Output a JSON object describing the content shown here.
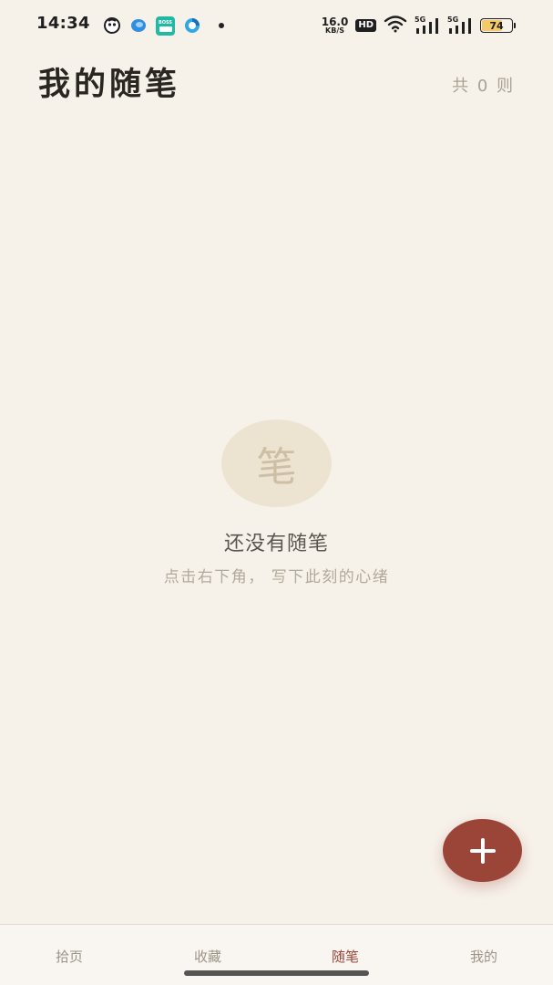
{
  "status_bar": {
    "time": "14:34",
    "net_speed_value": "16.0",
    "net_speed_unit": "KB/S",
    "hd_badge": "HD",
    "sim1_tag": "5G",
    "sim2_tag": "5G",
    "battery_level": "74",
    "battery_fraction": 0.74,
    "app_icons": [
      "app-icon",
      "messenger-icon",
      "boss-app-icon",
      "browser-icon"
    ],
    "boss_icon_text": "BOSS",
    "colors": {
      "battery_fill": "#f3c96a"
    }
  },
  "header": {
    "title": "我的随笔",
    "count_label": "共 0 则"
  },
  "empty_state": {
    "badge_char": "笔",
    "title": "还没有随笔",
    "subtitle": "点击右下角， 写下此刻的心绪"
  },
  "fab": {
    "icon": "plus-icon"
  },
  "bottom_nav": {
    "items": [
      {
        "label": "拾页",
        "active": false
      },
      {
        "label": "收藏",
        "active": false
      },
      {
        "label": "随笔",
        "active": true
      },
      {
        "label": "我的",
        "active": false
      }
    ]
  },
  "colors": {
    "background": "#f6f1e9",
    "accent": "#9b4538",
    "title": "#2a2723",
    "muted": "#a9a194"
  }
}
